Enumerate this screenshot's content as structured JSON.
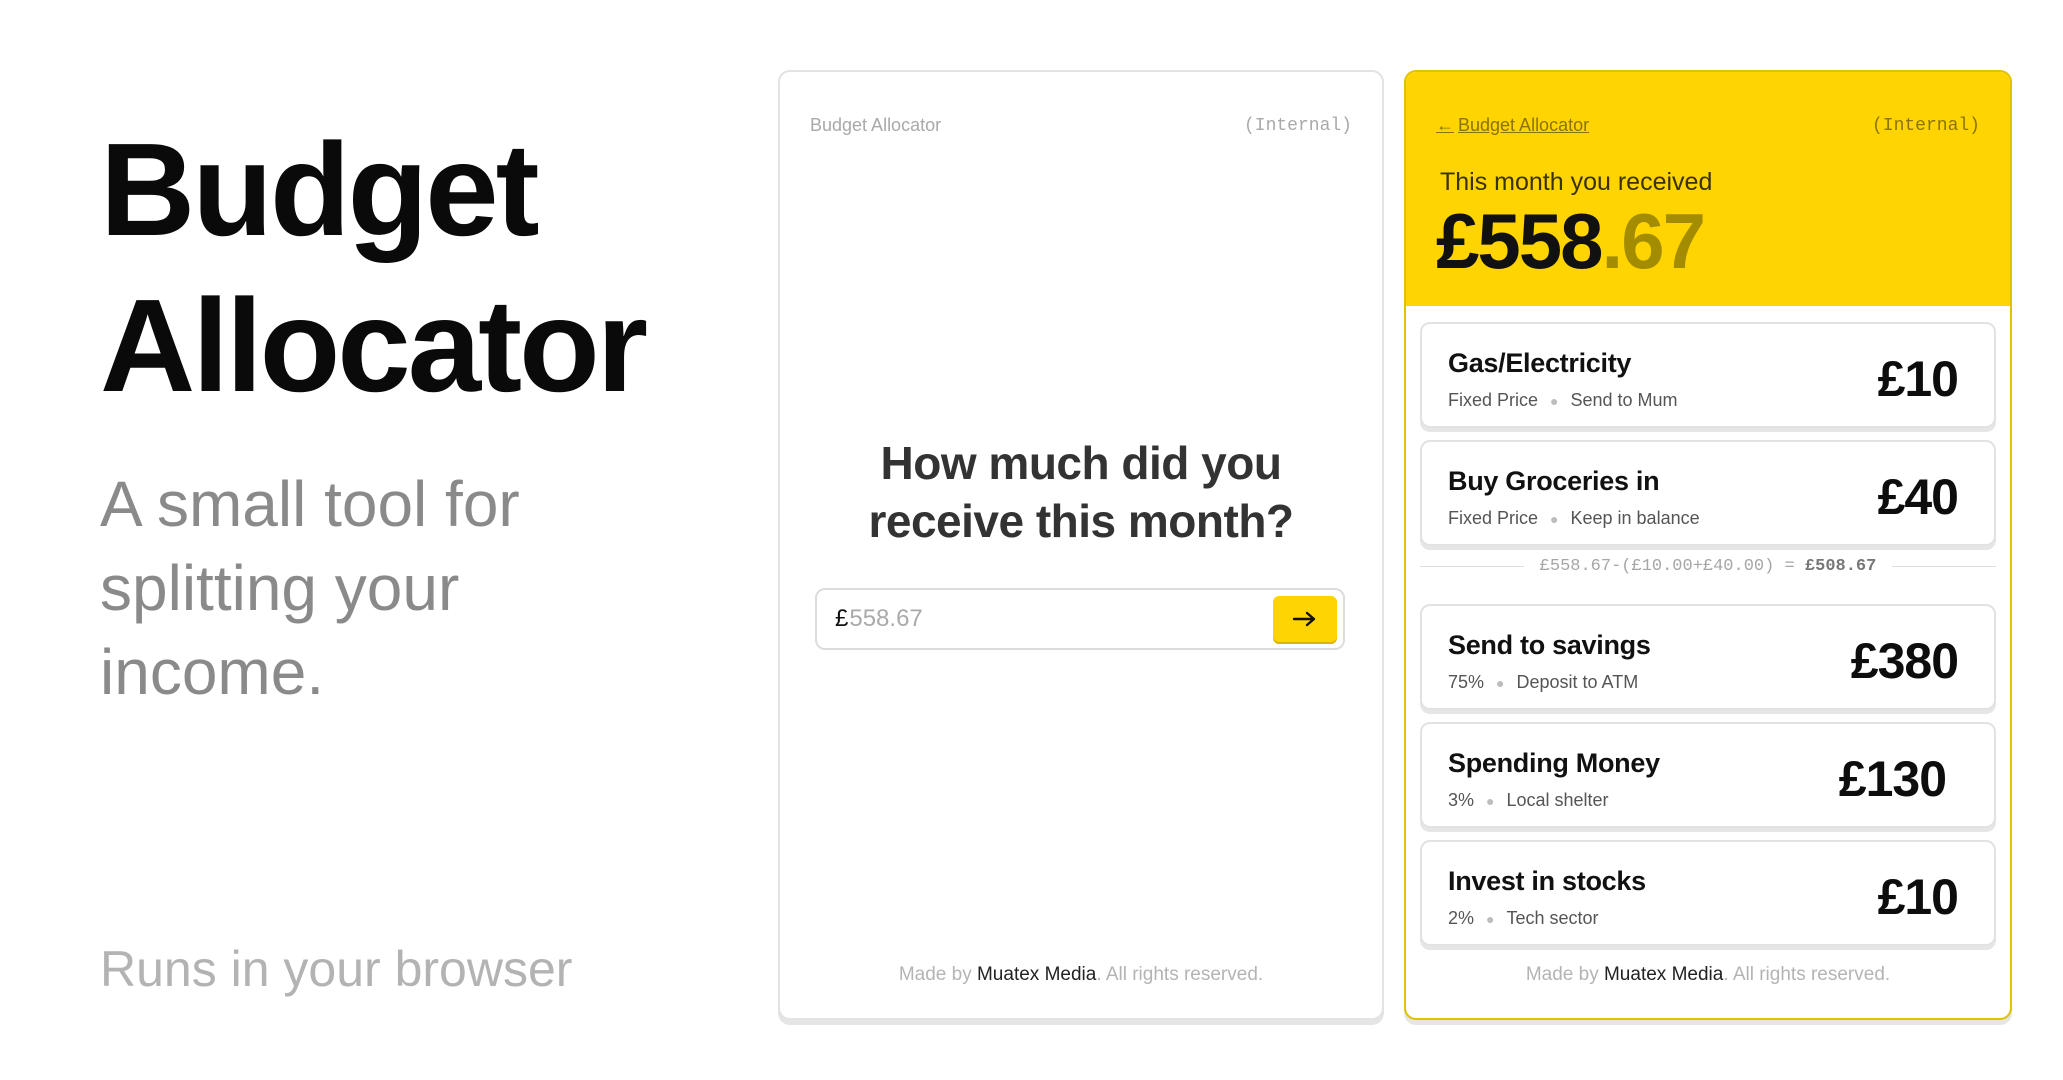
{
  "hero": {
    "title_line1": "Budget",
    "title_line2": "Allocator",
    "subtitle_line1": "A small tool for",
    "subtitle_line2": "splitting your",
    "subtitle_line3": "income.",
    "footer": "Runs in your browser"
  },
  "left_card": {
    "brand": "Budget Allocator",
    "tag": "(Internal)",
    "question_line1": "How much did you",
    "question_line2": "receive this month?",
    "currency_symbol": "£",
    "input_placeholder": "558.67",
    "submit_icon": "arrow-right-icon",
    "footer_prefix": "Made by ",
    "footer_company": "Muatex Media",
    "footer_suffix": ". All rights reserved."
  },
  "right_card": {
    "back_arrow": "←",
    "back_label": "Budget Allocator",
    "tag": "(Internal)",
    "received_label": "This month you received",
    "received_pounds": "£558",
    "received_pence": ".67",
    "fixed_items": [
      {
        "name": "Gas/Electricity",
        "type": "Fixed Price",
        "note": "Send to Mum",
        "amount": "£10"
      },
      {
        "name": "Buy Groceries in",
        "type": "Fixed Price",
        "note": "Keep in balance",
        "amount": "£40"
      }
    ],
    "calculation": "£558.67-(£10.00+£40.00) = ",
    "calculation_result": "£508.67",
    "percent_items": [
      {
        "name": "Send to savings",
        "type": "75%",
        "note": "Deposit to ATM",
        "amount": "£380"
      },
      {
        "name": "Spending Money",
        "type": "3%",
        "note": "Local shelter",
        "amount": "£130"
      },
      {
        "name": "Invest in stocks",
        "type": "2%",
        "note": "Tech sector",
        "amount": "£10"
      }
    ],
    "footer_prefix": "Made by ",
    "footer_company": "Muatex Media",
    "footer_suffix": ". All rights reserved."
  },
  "colors": {
    "accent": "#ffd400",
    "accent_dark": "#a38c00",
    "text_primary": "#111111",
    "text_muted": "#8a8a8a"
  }
}
